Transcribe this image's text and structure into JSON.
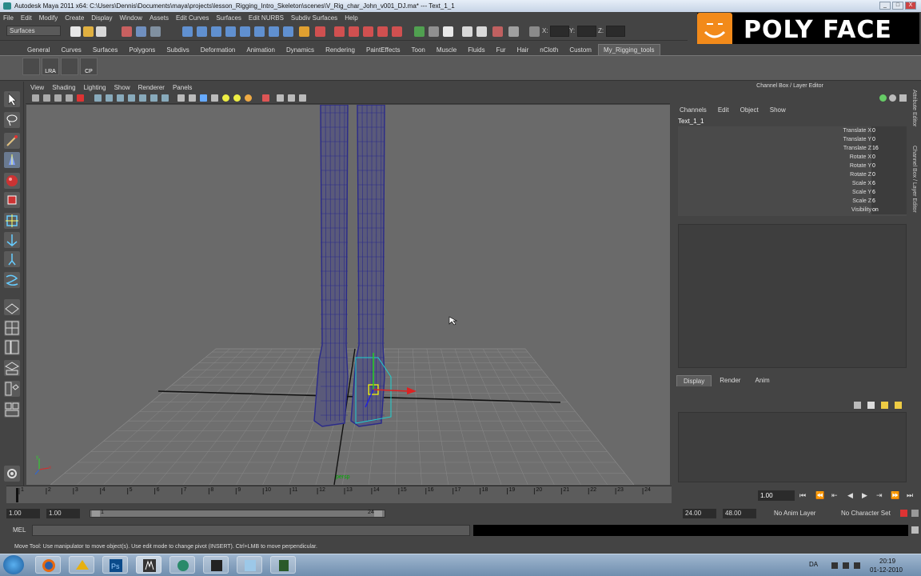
{
  "window": {
    "title": "Autodesk Maya 2011 x64: C:\\Users\\Dennis\\Documents\\maya\\projects\\lesson_Rigging_Intro_Skeleton\\scenes\\V_Rig_char_John_v001_DJ.ma*  ---  Text_1_1",
    "buttons": [
      "_",
      "□",
      "X"
    ]
  },
  "menubar": [
    "File",
    "Edit",
    "Modify",
    "Create",
    "Display",
    "Window",
    "Assets",
    "Edit Curves",
    "Surfaces",
    "Edit NURBS",
    "Subdiv Surfaces",
    "Help"
  ],
  "status_line": {
    "mode": "Surfaces",
    "coord_labels": [
      "X:",
      "Y:",
      "Z:"
    ]
  },
  "logo": {
    "text": "POLY FACE"
  },
  "shelf": {
    "tabs": [
      "General",
      "Curves",
      "Surfaces",
      "Polygons",
      "Subdivs",
      "Deformation",
      "Animation",
      "Dynamics",
      "Rendering",
      "PaintEffects",
      "Toon",
      "Muscle",
      "Fluids",
      "Fur",
      "Hair",
      "nCloth",
      "Custom",
      "My_Rigging_tools"
    ],
    "active_tab": "My_Rigging_tools",
    "buttons": [
      "",
      "LRA",
      "",
      "CP"
    ]
  },
  "toolbox": {
    "tools": [
      "select-tool",
      "lasso-tool",
      "paint-select-tool",
      "move-tool",
      "rotate-tool",
      "scale-tool",
      "universal-manipulator",
      "soft-mod-tool",
      "show-manipulator",
      "curve-tool"
    ]
  },
  "viewport": {
    "menu": [
      "View",
      "Shading",
      "Lighting",
      "Show",
      "Renderer",
      "Panels"
    ],
    "camera_label": "persp",
    "colors": {
      "background": "#6a6a6a",
      "grid": "#8a8a8a",
      "mesh": "#2a2a8a",
      "selection": "#1fd0d0"
    }
  },
  "channel_box": {
    "header": "Channel Box / Layer Editor",
    "menu": [
      "Channels",
      "Edit",
      "Object",
      "Show"
    ],
    "object_name": "Text_1_1",
    "attributes": [
      {
        "label": "Translate X",
        "value": "0"
      },
      {
        "label": "Translate Y",
        "value": "0"
      },
      {
        "label": "Translate Z",
        "value": "16"
      },
      {
        "label": "Rotate X",
        "value": "0"
      },
      {
        "label": "Rotate Y",
        "value": "0"
      },
      {
        "label": "Rotate Z",
        "value": "0"
      },
      {
        "label": "Scale X",
        "value": "6"
      },
      {
        "label": "Scale Y",
        "value": "6"
      },
      {
        "label": "Scale Z",
        "value": "6"
      },
      {
        "label": "Visibility",
        "value": "on"
      }
    ],
    "side_tabs": [
      "Attribute Editor",
      "Channel Box / Layer Editor"
    ]
  },
  "layer_editor": {
    "tabs": [
      "Display",
      "Render",
      "Anim"
    ],
    "active_tab": "Display"
  },
  "time_slider": {
    "ticks": [
      "1",
      "2",
      "3",
      "4",
      "5",
      "6",
      "7",
      "8",
      "9",
      "10",
      "11",
      "12",
      "13",
      "14",
      "15",
      "16",
      "17",
      "18",
      "19",
      "20",
      "21",
      "22",
      "23",
      "24"
    ],
    "current_time": "1.00"
  },
  "range_slider": {
    "start_time": "1.00",
    "playback_start": "1.00",
    "range_min_label": "1",
    "range_max_label": "24",
    "playback_end": "24.00",
    "end_time": "48.00",
    "anim_layer": "No Anim Layer",
    "character_set": "No Character Set"
  },
  "command_line": {
    "label": "MEL"
  },
  "help_line": "Move Tool: Use manipulator to move object(s). Use edit mode to change pivot (INSERT).  Ctrl+LMB to move perpendicular.",
  "taskbar": {
    "apps": [
      "firefox",
      "blender",
      "photoshop",
      "maya",
      "app-5",
      "app-6",
      "app-7",
      "app-8"
    ],
    "language": "DA",
    "time": "20:19",
    "date": "01-12-2010"
  }
}
